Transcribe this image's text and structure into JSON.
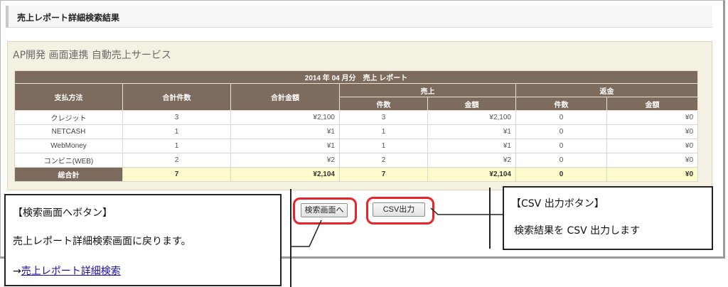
{
  "header": {
    "title": "売上レポート詳細検索結果"
  },
  "panel": {
    "title": "AP開発 画面連携 自動売上サービス",
    "table": {
      "caption": "2014 年 04 月分　売上 レポート",
      "columns": {
        "method": "支払方法",
        "total_count": "合計件数",
        "total_amount": "合計金額",
        "sales": "売上",
        "refund": "返金",
        "count": "件数",
        "amount": "金額"
      },
      "rows": [
        {
          "method": "クレジット",
          "total_count": "3",
          "total_amount": "¥2,100",
          "sales_count": "3",
          "sales_amount": "¥2,100",
          "refund_count": "0",
          "refund_amount": "¥0"
        },
        {
          "method": "NETCASH",
          "total_count": "1",
          "total_amount": "¥1",
          "sales_count": "1",
          "sales_amount": "¥1",
          "refund_count": "0",
          "refund_amount": "¥0"
        },
        {
          "method": "WebMoney",
          "total_count": "1",
          "total_amount": "¥1",
          "sales_count": "1",
          "sales_amount": "¥1",
          "refund_count": "0",
          "refund_amount": "¥0"
        },
        {
          "method": "コンビニ(WEB)",
          "total_count": "2",
          "total_amount": "¥2",
          "sales_count": "2",
          "sales_amount": "¥2",
          "refund_count": "0",
          "refund_amount": "¥0"
        }
      ],
      "total": {
        "label": "総合計",
        "total_count": "7",
        "total_amount": "¥2,104",
        "sales_count": "7",
        "sales_amount": "¥2,104",
        "refund_count": "0",
        "refund_amount": "¥0"
      }
    }
  },
  "buttons": {
    "search_screen": "検索画面へ",
    "csv": "CSV出力"
  },
  "callouts": {
    "search": {
      "title": "【検索画面へボタン】",
      "desc": "売上レポート詳細検索画面に戻ります。",
      "arrow": "→",
      "link": "売上レポート詳細検索"
    },
    "csv": {
      "title": "【CSV 出力ボタン】",
      "desc": "検索結果を CSV 出力します"
    }
  },
  "colors": {
    "table_header": "#7d6c5d",
    "total_row": "#fdfbcb",
    "highlight": "#e8232a"
  }
}
